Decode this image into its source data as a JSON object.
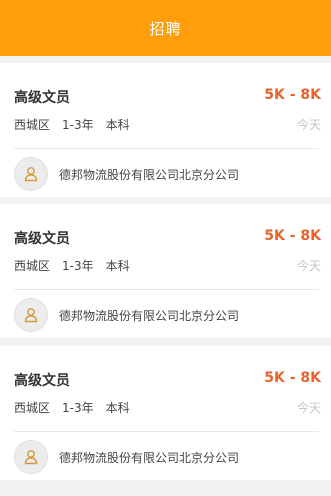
{
  "header": {
    "title": "招聘"
  },
  "colors": {
    "accent": "#ff9d0a",
    "salary": "#e8622c"
  },
  "jobs": [
    {
      "title": "高级文员",
      "salary": "5K - 8K",
      "district": "西城区",
      "experience": "1-3年",
      "education": "本科",
      "date": "今天",
      "company": "德邦物流股份有限公司北京分公司",
      "logo_icon": "person-avatar-icon"
    },
    {
      "title": "高级文员",
      "salary": "5K - 8K",
      "district": "西城区",
      "experience": "1-3年",
      "education": "本科",
      "date": "今天",
      "company": "德邦物流股份有限公司北京分公司",
      "logo_icon": "person-avatar-icon"
    },
    {
      "title": "高级文员",
      "salary": "5K - 8K",
      "district": "西城区",
      "experience": "1-3年",
      "education": "本科",
      "date": "今天",
      "company": "德邦物流股份有限公司北京分公司",
      "logo_icon": "person-avatar-icon"
    }
  ]
}
